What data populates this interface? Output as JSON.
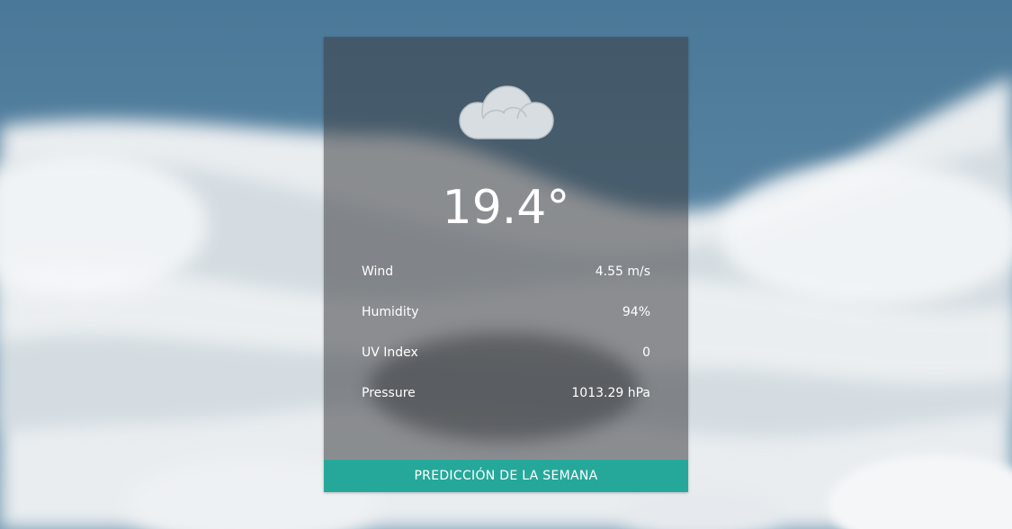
{
  "current": {
    "icon": "cloud-icon",
    "temperature": "19.4°"
  },
  "stats": [
    {
      "label": "Wind",
      "value": "4.55 m/s"
    },
    {
      "label": "Humidity",
      "value": "94%"
    },
    {
      "label": "UV Index",
      "value": "0"
    },
    {
      "label": "Pressure",
      "value": "1013.29 hPa"
    }
  ],
  "actions": {
    "week_forecast_label": "PREDICCIÓN DE LA SEMANA"
  },
  "colors": {
    "sky": "#4f7c9c",
    "card_overlay": "#3c3e42",
    "accent": "#25a89a",
    "icon_fill": "#d7dde0"
  }
}
